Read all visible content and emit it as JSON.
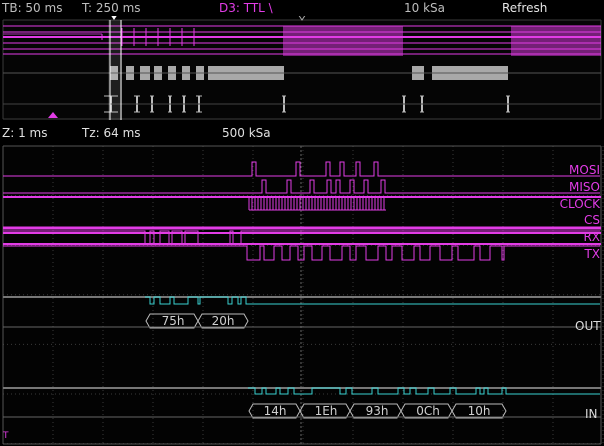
{
  "top_bar": {
    "timebase": "TB: 50 ms",
    "trigger_time": "T: 250 ms",
    "trigger_source": "D3: TTL \\",
    "sample_rate": "10 kSa",
    "refresh": "Refresh"
  },
  "zoom_bar": {
    "zoom": "Z: 1 ms",
    "zoom_trigger": "Tz: 64 ms",
    "sample_rate": "500 kSa"
  },
  "channels": [
    {
      "label": "MOSI"
    },
    {
      "label": "MISO"
    },
    {
      "label": "CLOCK"
    },
    {
      "label": "CS"
    },
    {
      "label": "RX"
    },
    {
      "label": "TX"
    }
  ],
  "buses": {
    "out": {
      "label": "OUT",
      "values": [
        "75h",
        "20h"
      ]
    },
    "in": {
      "label": "IN",
      "values": [
        "14h",
        "1Eh",
        "93h",
        "0Ch",
        "10h"
      ]
    }
  },
  "trigger_marker": "T",
  "colors": {
    "digital": "#e23ce6",
    "bus": "#3ad0d0",
    "grid": "#3a3a3a",
    "text": "#d8d8d8"
  }
}
